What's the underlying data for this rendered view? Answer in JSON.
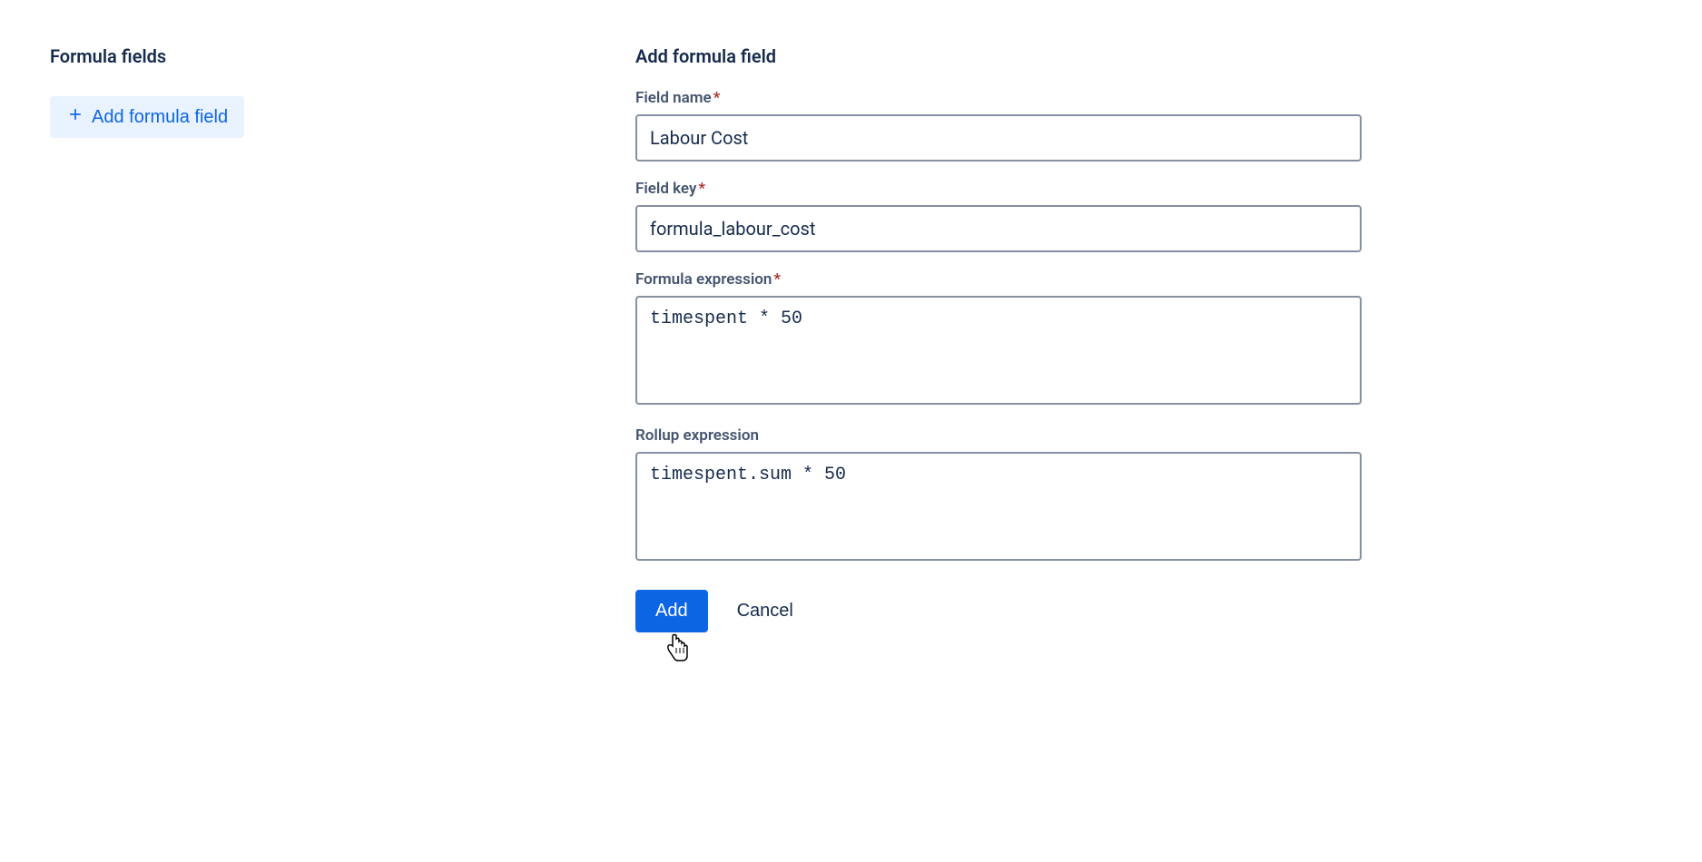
{
  "sidebar": {
    "title": "Formula fields",
    "add_button_label": "Add formula field"
  },
  "form": {
    "title": "Add formula field",
    "field_name": {
      "label": "Field name",
      "required": true,
      "value": "Labour Cost"
    },
    "field_key": {
      "label": "Field key",
      "required": true,
      "value": "formula_labour_cost"
    },
    "formula_expression": {
      "label": "Formula expression",
      "required": true,
      "value": "timespent * 50"
    },
    "rollup_expression": {
      "label": "Rollup expression",
      "required": false,
      "value": "timespent.sum * 50"
    },
    "buttons": {
      "submit": "Add",
      "cancel": "Cancel"
    }
  }
}
